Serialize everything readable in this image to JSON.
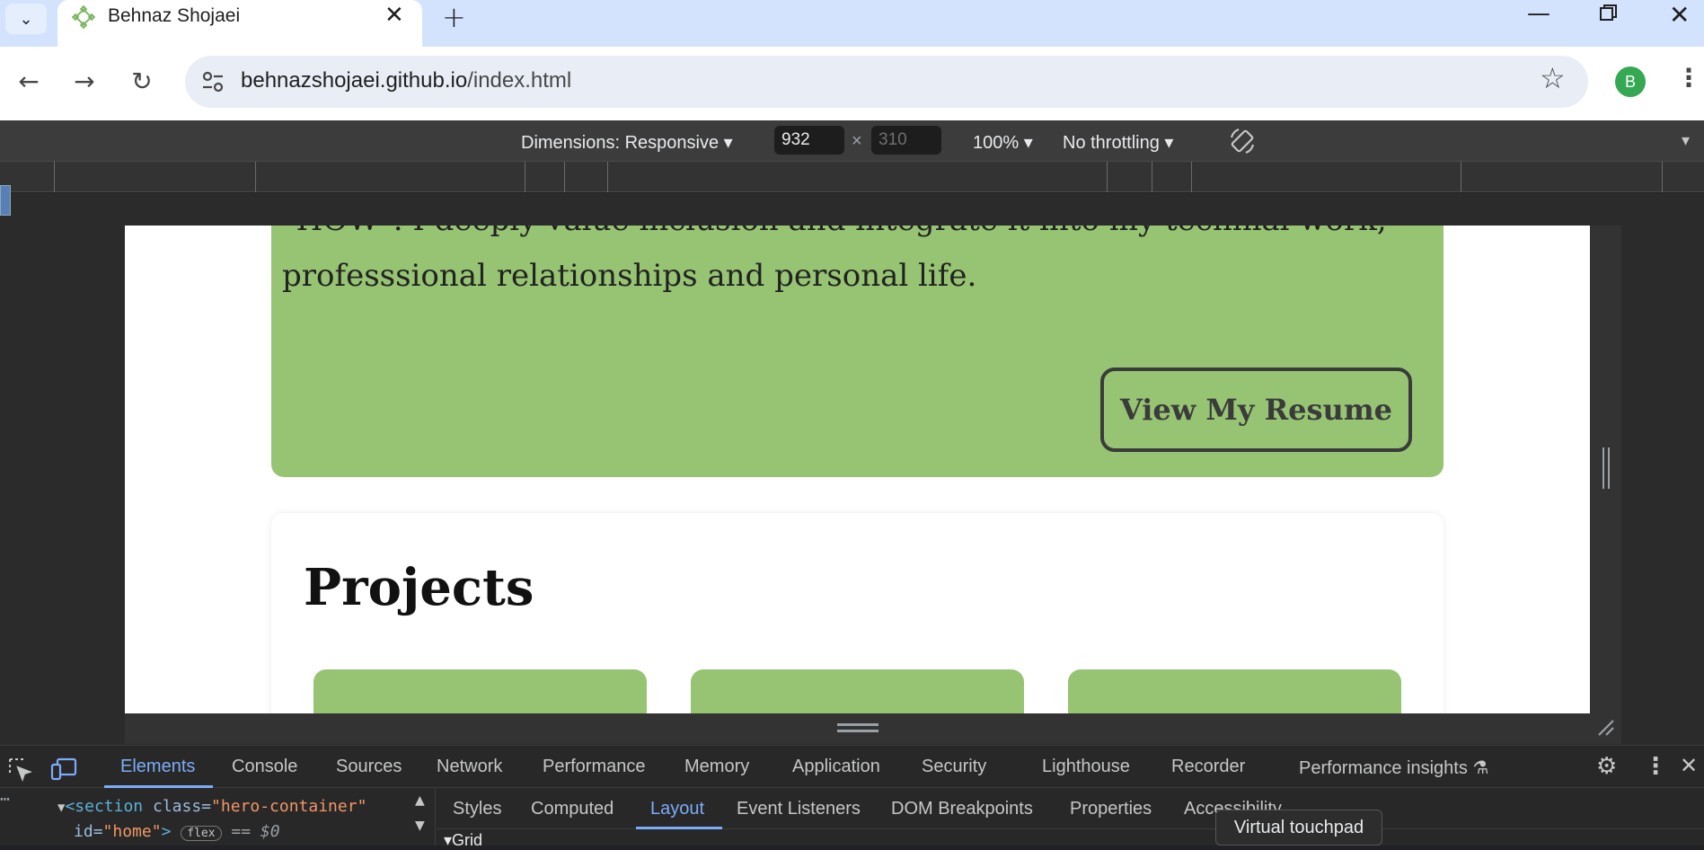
{
  "browser": {
    "tab_title": "Behnaz Shojaei",
    "url_host": "behnazshojaei.github.io",
    "url_path": "/index.html",
    "profile_initial": "B",
    "profile_color": "#34a853"
  },
  "device_toolbar": {
    "dimensions_label": "Dimensions: Responsive",
    "width_value": "932",
    "times": "×",
    "height_placeholder": "310",
    "zoom": "100%",
    "throttling": "No throttling"
  },
  "page": {
    "hero_line1": "\"HOW\". I deeply value inclusion and integrate it into my technial work,",
    "hero_line2": "professsional relationships and personal life.",
    "resume_button": "View My Resume",
    "projects_heading": "Projects",
    "accent_color": "#96c473"
  },
  "devtools": {
    "main_tabs": [
      "Elements",
      "Console",
      "Sources",
      "Network",
      "Performance",
      "Memory",
      "Application",
      "Security",
      "Lighthouse",
      "Recorder",
      "Performance insights"
    ],
    "active_tab": "Elements",
    "code_line1_tag": "<section",
    "code_line1_attr": "class",
    "code_line1_val": "\"hero-container\"",
    "code_line2_attr": "id",
    "code_line2_val": "\"home\"",
    "code_line2_tail": ">",
    "flex_badge": "flex",
    "dollar0": "== $0",
    "sub_tabs": [
      "Styles",
      "Computed",
      "Layout",
      "Event Listeners",
      "DOM Breakpoints",
      "Properties",
      "Accessibility"
    ],
    "active_sub_tab": "Layout",
    "grid_label": "Grid",
    "tooltip": "Virtual touchpad"
  }
}
